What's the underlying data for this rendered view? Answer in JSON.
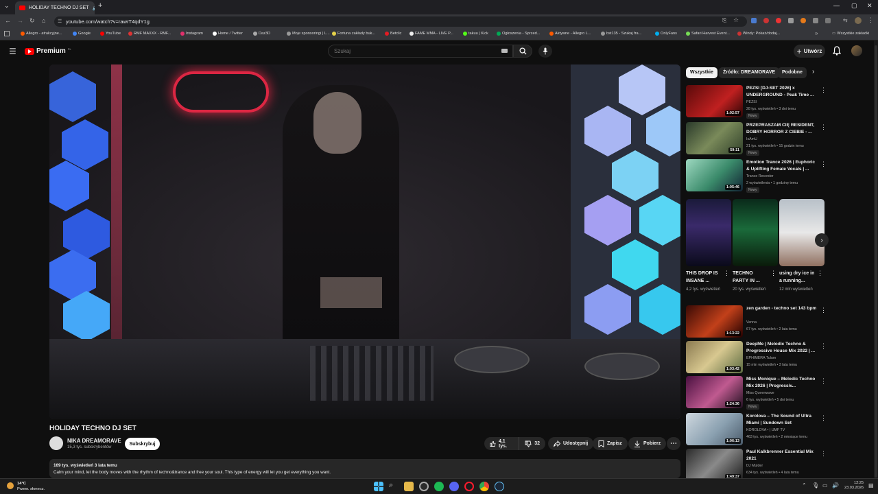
{
  "browser": {
    "tab_title": "HOLIDAY TECHNO DJ SET",
    "url": "youtube.com/watch?v=rawrT4qdY1g",
    "bookmarks": [
      "Allegro - atrakcyjne...",
      "Google",
      "YouTube",
      "RMF MAXXX - RMF...",
      "Instagram",
      "Home / Twitter",
      "Daz3D",
      "Moje sponsoringi | L...",
      "Fortuna zakłady buk...",
      "Betclic",
      "FAME MMA - LIVE P...",
      "takuu | Kick",
      "Ogłoszenia - Sprzed...",
      "Aktywne - Allegro L...",
      "bst135 - Szukaj fra...",
      "OnlyFans",
      "Safari Harvest Event...",
      "Windy: Pokaż/dodaj..."
    ],
    "all_bookmarks": "Wszystkie zakładki"
  },
  "header": {
    "logo_text": "Premium",
    "logo_sup": "PL",
    "search_placeholder": "Szukaj",
    "create_label": "Utwórz"
  },
  "video": {
    "title": "HOLIDAY TECHNO DJ SET",
    "channel": "NIKA DREAMORAVE",
    "subscribers": "15,3 tys. subskrybentów",
    "subscribe_label": "Subskrybuj",
    "likes": "4,1 tys.",
    "dislikes": "32",
    "share_label": "Udostępnij",
    "save_label": "Zapisz",
    "download_label": "Pobierz",
    "views": "169 tys. wyświetleń",
    "date": "3 lata temu",
    "description": "Calm your mind, let the body moves with the rhythm of techno&trance and free your soul. This type of energy will let you get everything you want."
  },
  "chips": [
    "Wszystkie",
    "Źródło: DREAMORAVE",
    "Podobne"
  ],
  "recommendations": [
    {
      "title": "PEZSI [DJ-SET 2026] x UNDERGROUND - Peak Time ...",
      "channel": "PEZSI",
      "meta": "28 tys. wyświetleń • 3 dni temu",
      "badge": "Nowy",
      "duration": "1:02:57"
    },
    {
      "title": "PRZEPRASZAM CIĘ RESIDENT, DOBRY HORROR Z CIEBIE - ...",
      "channel": "IsAmU",
      "meta": "21 tys. wyświetleń • 15 godzin temu",
      "badge": "Nowy",
      "duration": "59:11"
    },
    {
      "title": "Emotion Trance 2026 | Euphoric & Uplifting Female Vocals | ...",
      "channel": "Trance Recorder",
      "meta": "2 wyświetlenia • 1 godzinę temu",
      "badge": "Nowy",
      "duration": "1:05:46"
    },
    {
      "title": "zen garden - techno set 143 bpm",
      "channel": "Venna",
      "meta": "67 tys. wyświetleń • 2 lata temu",
      "badge": "",
      "duration": "1:13:22"
    },
    {
      "title": "DeepMe | Melodic Techno & Progressive House Mix 2022 | ...",
      "channel": "EPHIMERA Tulum",
      "meta": "15 mln wyświetleń • 3 lata temu",
      "badge": "",
      "duration": "1:03:42"
    },
    {
      "title": "Miss Monique – Melodic Techno Mix 2026 | Progressiv...",
      "channel": "Miss Queenwave",
      "meta": "6 tys. wyświetleń • 5 dni temu",
      "badge": "Nowy",
      "duration": "1:24:36"
    },
    {
      "title": "Korolova – The Sound of Ultra Miami | Sundown Set",
      "channel": "KOROLOVA • | UMF TV",
      "meta": "463 tys. wyświetleń • 2 miesiące temu",
      "badge": "",
      "duration": "1:06:13"
    },
    {
      "title": "Paul Kalkbrenner Essential Mix 2021",
      "channel": "DJ Mulder",
      "meta": "634 tys. wyświetleń • 4 lata temu",
      "badge": "",
      "duration": "1:49:37"
    }
  ],
  "shorts": [
    {
      "title": "THIS DROP IS INSANE ...",
      "views": "4,2 tys. wyświetleń"
    },
    {
      "title": "TECHNO PARTY IN ...",
      "views": "20 tys. wyświetleń"
    },
    {
      "title": "using dry ice in a running...",
      "views": "12 mln wyświetleń"
    }
  ],
  "taskbar": {
    "weather_temp": "14°C",
    "weather_desc": "Przew. słonecz.",
    "time": "12:25",
    "date": "23.03.2026"
  },
  "colors": {
    "accent_red": "#ff0000",
    "background": "#0f0f0f",
    "chip_bg": "#272727"
  },
  "icons": [
    "menu-icon",
    "search-icon",
    "mic-icon",
    "bell-icon",
    "like-icon",
    "dislike-icon",
    "share-icon",
    "save-icon",
    "download-icon",
    "more-icon"
  ]
}
